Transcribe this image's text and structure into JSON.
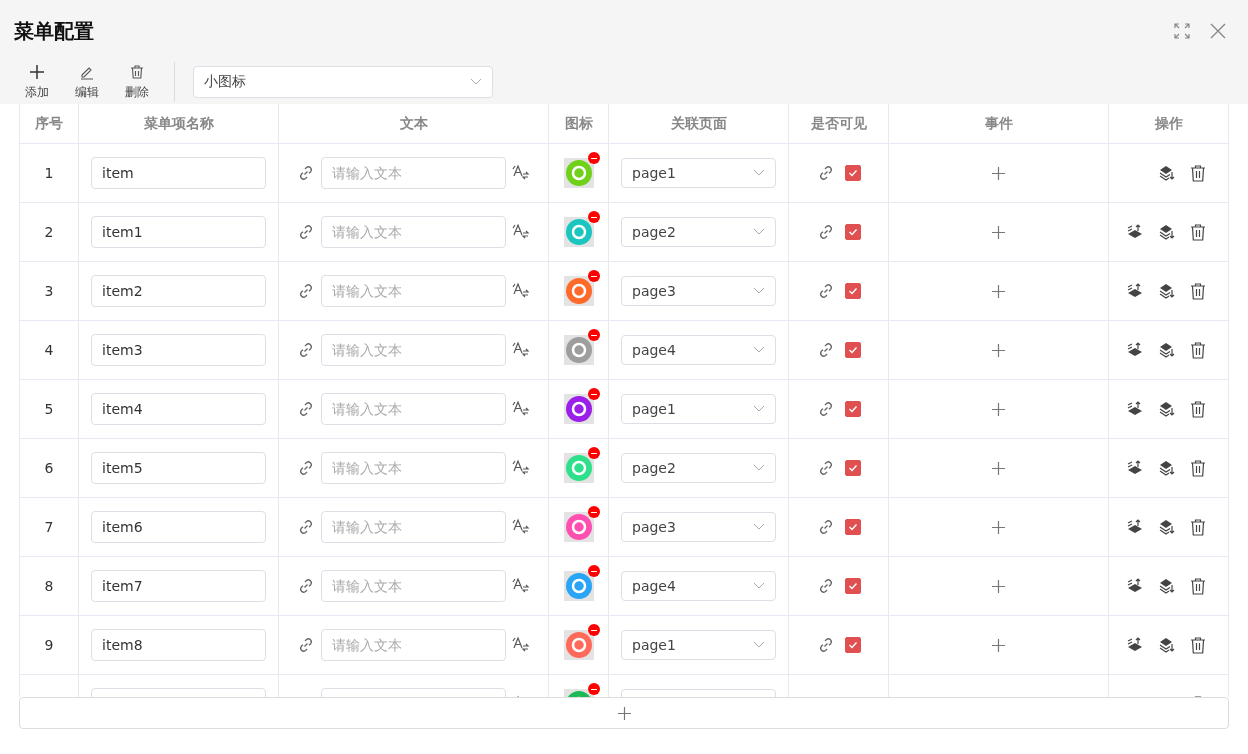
{
  "dialog": {
    "title": "菜单配置"
  },
  "toolbar": [
    {
      "kind": "add",
      "label": "添加"
    },
    {
      "kind": "edit",
      "label": "编辑"
    },
    {
      "kind": "delete",
      "label": "删除"
    }
  ],
  "style_select": {
    "value": "小图标"
  },
  "table": {
    "columns": [
      "序号",
      "菜单项名称",
      "文本",
      "图标",
      "关联页面",
      "是否可见",
      "事件",
      "操作"
    ],
    "rows": [
      {
        "index": "1",
        "name": "item",
        "text_placeholder": "请输入文本",
        "color": "#6fd11a",
        "page": "page1",
        "visible": true,
        "can_move_up": false
      },
      {
        "index": "2",
        "name": "item1",
        "text_placeholder": "请输入文本",
        "color": "#1cc6c0",
        "page": "page2",
        "visible": true,
        "can_move_up": true
      },
      {
        "index": "3",
        "name": "item2",
        "text_placeholder": "请输入文本",
        "color": "#ff6a2b",
        "page": "page3",
        "visible": true,
        "can_move_up": true
      },
      {
        "index": "4",
        "name": "item3",
        "text_placeholder": "请输入文本",
        "color": "#9e9e9e",
        "page": "page4",
        "visible": true,
        "can_move_up": true
      },
      {
        "index": "5",
        "name": "item4",
        "text_placeholder": "请输入文本",
        "color": "#9b1fe8",
        "page": "page1",
        "visible": true,
        "can_move_up": true
      },
      {
        "index": "6",
        "name": "item5",
        "text_placeholder": "请输入文本",
        "color": "#2ee08a",
        "page": "page2",
        "visible": true,
        "can_move_up": true
      },
      {
        "index": "7",
        "name": "item6",
        "text_placeholder": "请输入文本",
        "color": "#ff4fb0",
        "page": "page3",
        "visible": true,
        "can_move_up": true
      },
      {
        "index": "8",
        "name": "item7",
        "text_placeholder": "请输入文本",
        "color": "#2aa4f4",
        "page": "page4",
        "visible": true,
        "can_move_up": true
      },
      {
        "index": "9",
        "name": "item8",
        "text_placeholder": "请输入文本",
        "color": "#ff6a5b",
        "page": "page1",
        "visible": true,
        "can_move_up": true
      },
      {
        "color": "#1db954"
      }
    ]
  }
}
